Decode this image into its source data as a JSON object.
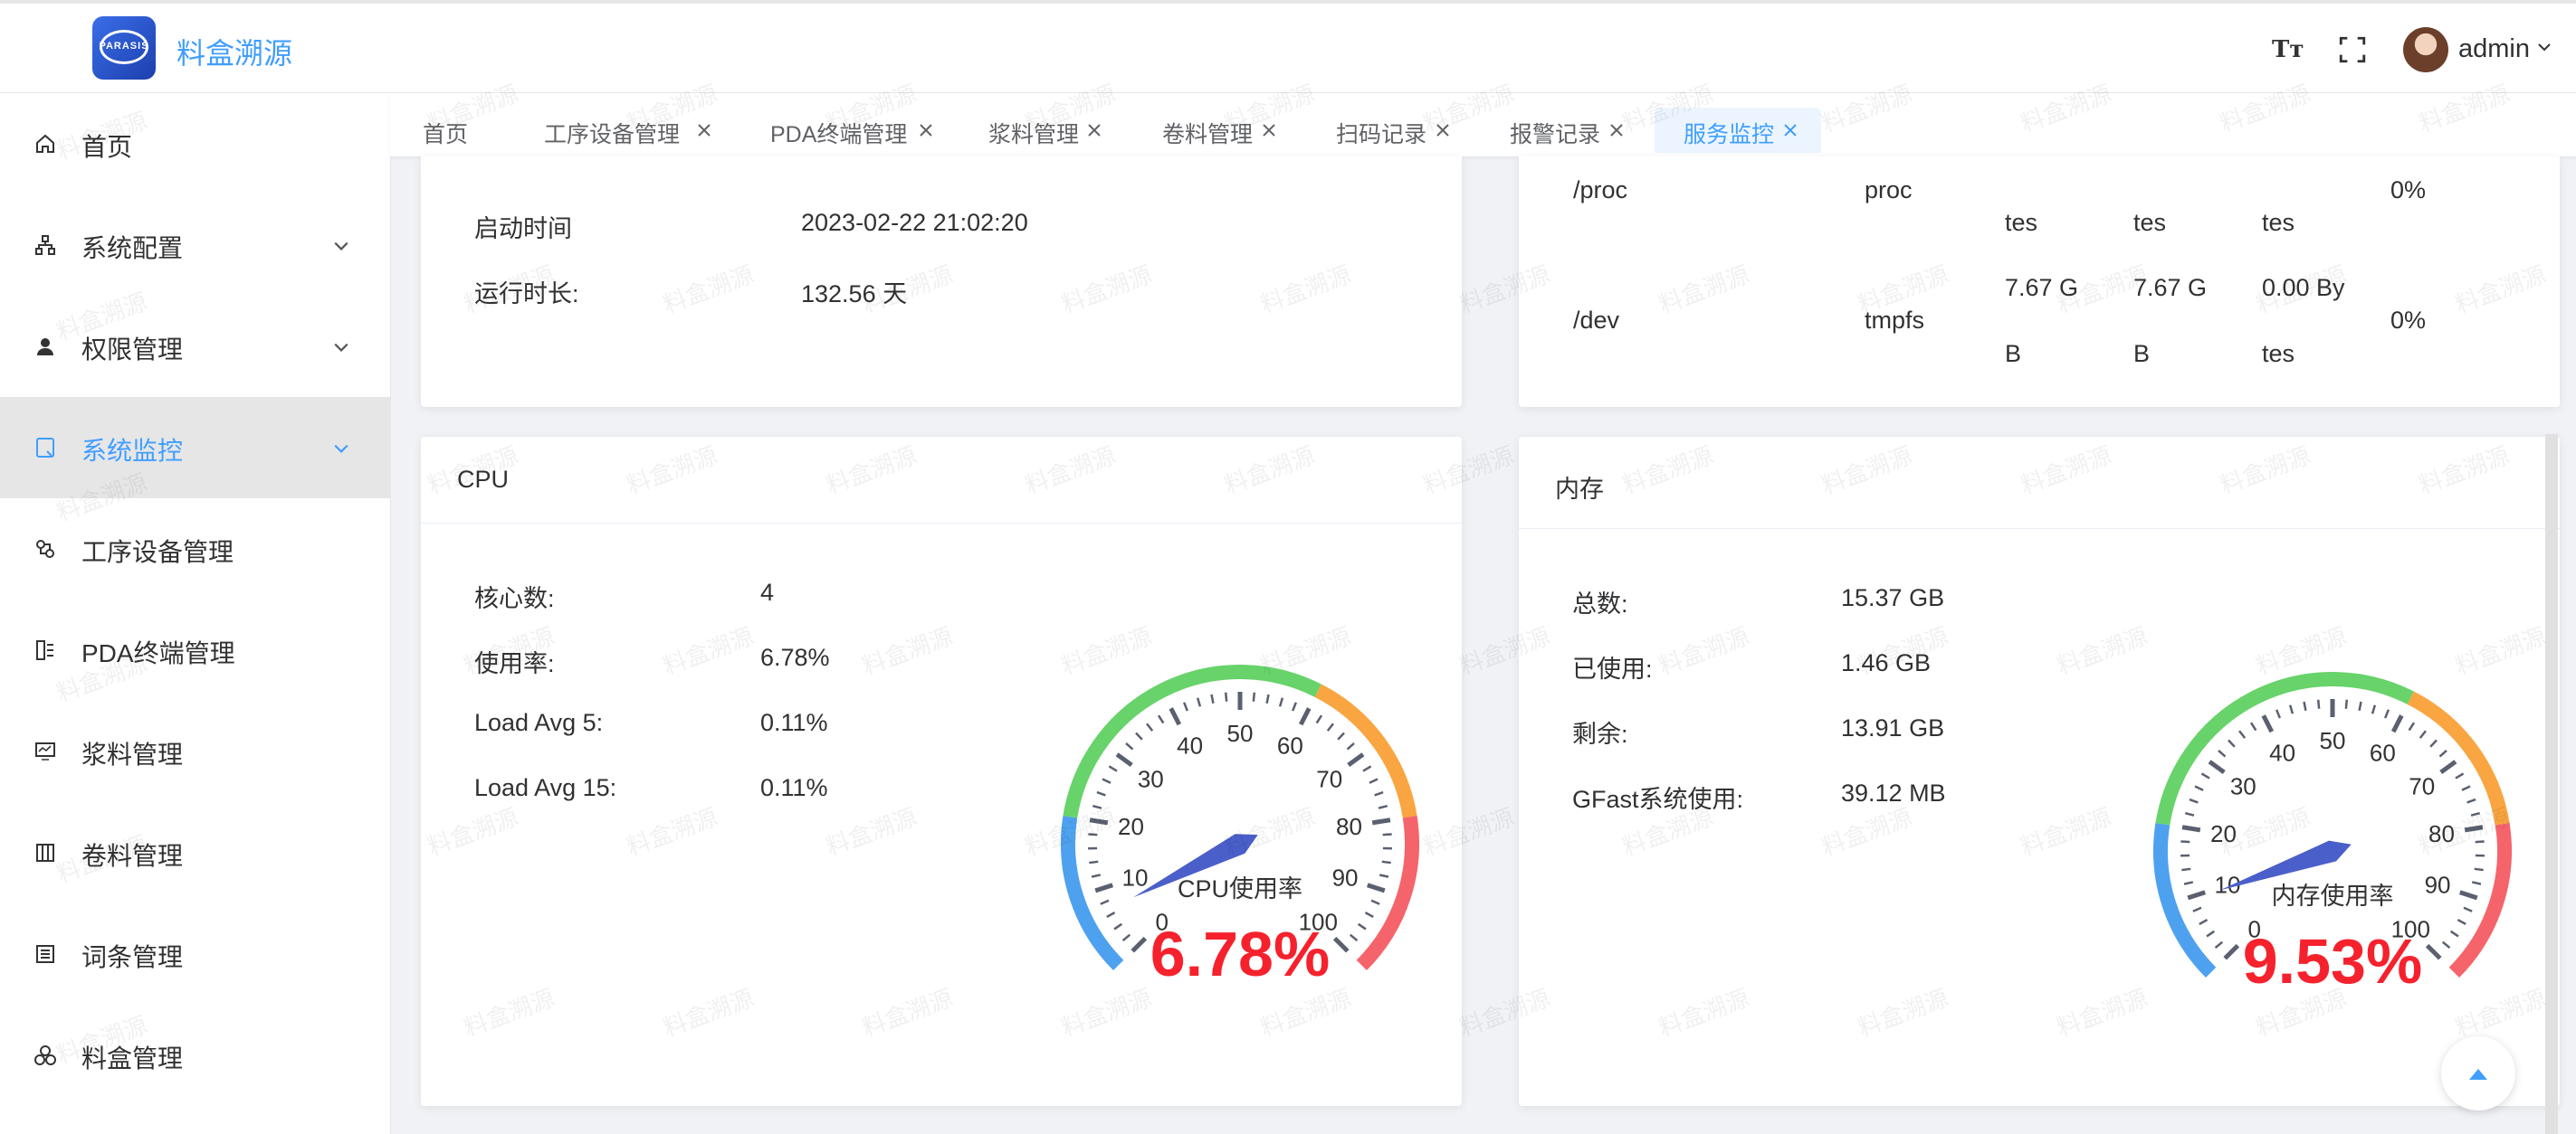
{
  "app": {
    "title": "料盒溯源",
    "logo_text": "PARASIS"
  },
  "header": {
    "user_name": "admin",
    "font_icon_text": "Tт"
  },
  "watermark_text": "料盒溯源",
  "colors": {
    "accent": "#409eff",
    "gauge_value": "#f5222d",
    "gauge_blue": "#4ea1ef",
    "gauge_green": "#67d36a",
    "gauge_orange": "#f9a541",
    "gauge_red": "#f5646b",
    "needle": "#4a5fc9"
  },
  "sidebar": {
    "items": [
      {
        "label": "首页",
        "icon": "home-icon",
        "expandable": false,
        "active": false
      },
      {
        "label": "系统配置",
        "icon": "sitemap-icon",
        "expandable": true,
        "active": false
      },
      {
        "label": "权限管理",
        "icon": "user-icon",
        "expandable": true,
        "active": false
      },
      {
        "label": "系统监控",
        "icon": "monitor-icon",
        "expandable": true,
        "active": true
      },
      {
        "label": "工序设备管理",
        "icon": "process-icon",
        "expandable": false,
        "active": false
      },
      {
        "label": "PDA终端管理",
        "icon": "terminal-icon",
        "expandable": false,
        "active": false
      },
      {
        "label": "浆料管理",
        "icon": "screen-icon",
        "expandable": false,
        "active": false
      },
      {
        "label": "卷料管理",
        "icon": "columns-icon",
        "expandable": false,
        "active": false
      },
      {
        "label": "词条管理",
        "icon": "list-icon",
        "expandable": false,
        "active": false
      },
      {
        "label": "料盒管理",
        "icon": "boxes-icon",
        "expandable": false,
        "active": false
      }
    ]
  },
  "tabs": [
    {
      "label": "首页",
      "closable": false,
      "active": false
    },
    {
      "label": "工序设备管理",
      "closable": true,
      "active": false
    },
    {
      "label": "PDA终端管理",
      "closable": true,
      "active": false
    },
    {
      "label": "浆料管理",
      "closable": true,
      "active": false
    },
    {
      "label": "卷料管理",
      "closable": true,
      "active": false
    },
    {
      "label": "扫码记录",
      "closable": true,
      "active": false
    },
    {
      "label": "报警记录",
      "closable": true,
      "active": false
    },
    {
      "label": "服务监控",
      "closable": true,
      "active": true
    }
  ],
  "server_info": {
    "rows": [
      {
        "label": "启动时间",
        "value": "2023-02-22 21:02:20"
      },
      {
        "label": "运行时长:",
        "value": "132.56 天"
      }
    ]
  },
  "disk": {
    "rows": [
      {
        "path": "/proc",
        "type": "proc",
        "total": [
          "tes"
        ],
        "free": [
          "tes"
        ],
        "used": [
          "tes"
        ],
        "percent": "0%"
      },
      {
        "path": "/dev",
        "type": "tmpfs",
        "total": [
          "7.67 G",
          "B"
        ],
        "free": [
          "7.67 G",
          "B"
        ],
        "used": [
          "0.00 By",
          "tes"
        ],
        "percent": "0%"
      }
    ]
  },
  "cpu": {
    "title": "CPU",
    "rows": [
      {
        "label": "核心数:",
        "value": "4"
      },
      {
        "label": "使用率:",
        "value": "6.78%"
      },
      {
        "label": "Load Avg 5:",
        "value": "0.11%"
      },
      {
        "label": "Load Avg 15:",
        "value": "0.11%"
      }
    ],
    "gauge": {
      "name": "CPU使用率",
      "value": 6.78,
      "display": "6.78%",
      "min": 0,
      "max": 100,
      "ticks": [
        "0",
        "10",
        "20",
        "30",
        "40",
        "50",
        "60",
        "70",
        "80",
        "90",
        "100"
      ]
    }
  },
  "memory": {
    "title": "内存",
    "rows": [
      {
        "label": "总数:",
        "value": "15.37 GB"
      },
      {
        "label": "已使用:",
        "value": "1.46 GB"
      },
      {
        "label": "剩余:",
        "value": "13.91 GB"
      },
      {
        "label": "GFast系统使用:",
        "value": "39.12 MB"
      }
    ],
    "gauge": {
      "name": "内存使用率",
      "value": 9.53,
      "display": "9.53%",
      "min": 0,
      "max": 100,
      "ticks": [
        "0",
        "10",
        "20",
        "30",
        "40",
        "50",
        "60",
        "70",
        "80",
        "90",
        "100"
      ]
    }
  }
}
